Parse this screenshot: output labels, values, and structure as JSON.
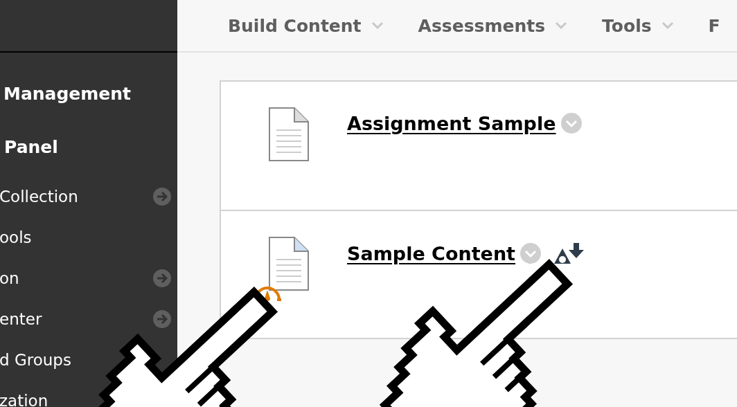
{
  "top_menu": [
    {
      "label": "Build Content"
    },
    {
      "label": "Assessments"
    },
    {
      "label": "Tools"
    },
    {
      "label": "F"
    }
  ],
  "sidebar": {
    "headings": [
      "Management",
      "Panel"
    ],
    "items": [
      {
        "label": "Collection",
        "arrow": true
      },
      {
        "label": "ools",
        "arrow": false
      },
      {
        "label": "on",
        "arrow": true
      },
      {
        "label": "enter",
        "arrow": true
      },
      {
        "label": "d Groups",
        "arrow": false
      },
      {
        "label": "zation"
      }
    ]
  },
  "content_items": [
    {
      "title": "Assignment Sample",
      "color": "#dddddd",
      "tracking": false,
      "alternative_formats": false
    },
    {
      "title": "Sample Content",
      "color": "#cfe0f4",
      "tracking": true,
      "alternative_formats": true
    }
  ]
}
